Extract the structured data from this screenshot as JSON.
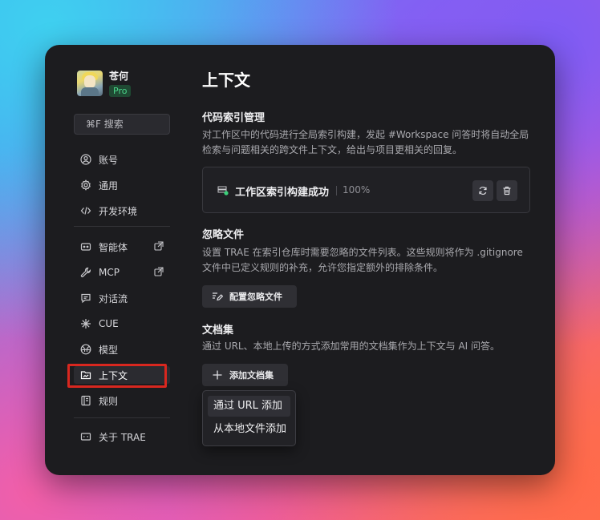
{
  "sidebar": {
    "user_name": "苍何",
    "badge": "Pro",
    "search_placeholder": "⌘F 搜索",
    "items": [
      {
        "label": "账号",
        "icon": "user-circle-icon"
      },
      {
        "label": "通用",
        "icon": "gear-icon"
      },
      {
        "label": "开发环境",
        "icon": "code-icon"
      },
      {
        "label": "智能体",
        "icon": "agent-icon"
      },
      {
        "label": "MCP",
        "icon": "wrench-icon"
      },
      {
        "label": "对话流",
        "icon": "chat-flow-icon"
      },
      {
        "label": "CUE",
        "icon": "sparkle-icon"
      },
      {
        "label": "模型",
        "icon": "model-icon"
      },
      {
        "label": "上下文",
        "icon": "folder-context-icon"
      },
      {
        "label": "规则",
        "icon": "rules-icon"
      },
      {
        "label": "关于 TRAE",
        "icon": "trae-icon"
      }
    ],
    "active_index": 8
  },
  "main": {
    "title": "上下文",
    "code_index": {
      "title": "代码索引管理",
      "description": "对工作区中的代码进行全局索引构建，发起 #Workspace 问答时将自动全局检索与问题相关的跨文件上下文，给出与项目更相关的回复。",
      "status": "工作区索引构建成功",
      "progress": "100%"
    },
    "ignore": {
      "title": "忽略文件",
      "description": "设置 TRAE 在索引仓库时需要忽略的文件列表。这些规则将作为 .gitignore 文件中已定义规则的补充，允许您指定额外的排除条件。",
      "button": "配置忽略文件"
    },
    "docs": {
      "title": "文档集",
      "description": "通过 URL、本地上传的方式添加常用的文档集作为上下文与 AI 问答。",
      "button": "添加文档集",
      "menu": [
        "通过 URL 添加",
        "从本地文件添加"
      ]
    }
  },
  "colors": {
    "window_bg": "#1c1c1f",
    "pro_badge": "#4bd58a",
    "highlight_outline": "#d8271f"
  }
}
